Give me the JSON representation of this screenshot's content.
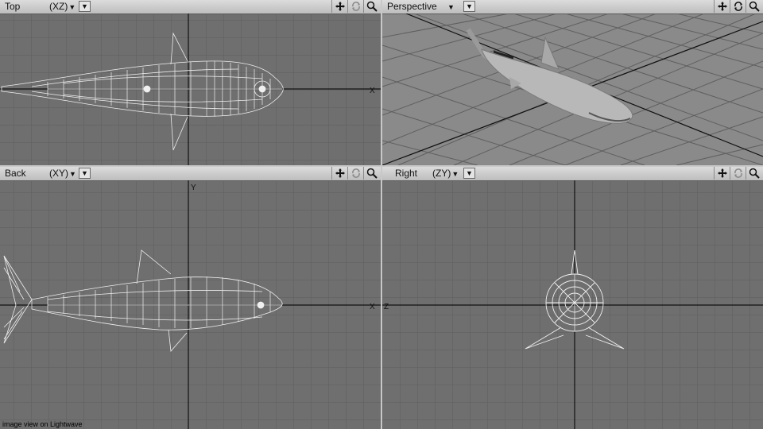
{
  "viewports": [
    {
      "id": "top",
      "name": "Top",
      "projection": "(XZ)"
    },
    {
      "id": "perspective",
      "name": "Perspective",
      "projection": ""
    },
    {
      "id": "back",
      "name": "Back",
      "projection": "(XY)"
    },
    {
      "id": "right",
      "name": "Right",
      "projection": "(ZY)"
    }
  ],
  "axis_labels": {
    "x": "X",
    "y": "Y",
    "z": "Z"
  },
  "tools": [
    "move-view-icon",
    "rotate-view-icon",
    "zoom-view-icon"
  ],
  "caption": "image view on Lightwave",
  "colors": {
    "viewport_bg": "#6f6f6f",
    "grid": "#5c5c5c",
    "axis": "#101010",
    "wire": "#f2f2f2",
    "header": "#c8c8c8"
  }
}
